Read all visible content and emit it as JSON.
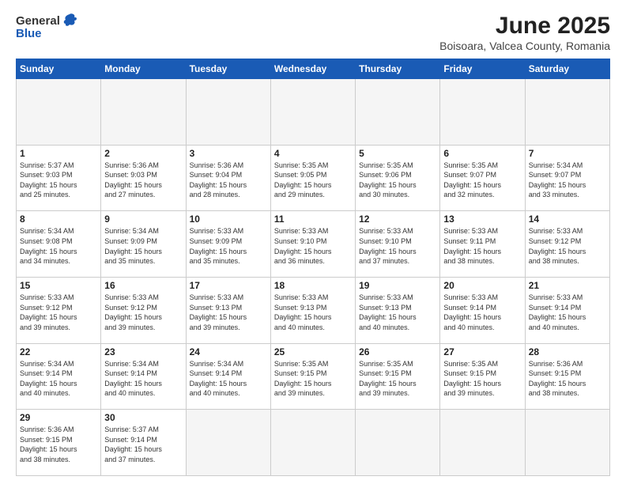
{
  "header": {
    "logo_general": "General",
    "logo_blue": "Blue",
    "title": "June 2025",
    "subtitle": "Boisoara, Valcea County, Romania"
  },
  "calendar": {
    "days_of_week": [
      "Sunday",
      "Monday",
      "Tuesday",
      "Wednesday",
      "Thursday",
      "Friday",
      "Saturday"
    ],
    "weeks": [
      [
        {
          "day": "",
          "empty": true
        },
        {
          "day": "",
          "empty": true
        },
        {
          "day": "",
          "empty": true
        },
        {
          "day": "",
          "empty": true
        },
        {
          "day": "",
          "empty": true
        },
        {
          "day": "",
          "empty": true
        },
        {
          "day": "",
          "empty": true
        }
      ],
      [
        {
          "day": "1",
          "sunrise": "5:37 AM",
          "sunset": "9:03 PM",
          "daylight": "15 hours and 25 minutes."
        },
        {
          "day": "2",
          "sunrise": "5:36 AM",
          "sunset": "9:03 PM",
          "daylight": "15 hours and 27 minutes."
        },
        {
          "day": "3",
          "sunrise": "5:36 AM",
          "sunset": "9:04 PM",
          "daylight": "15 hours and 28 minutes."
        },
        {
          "day": "4",
          "sunrise": "5:35 AM",
          "sunset": "9:05 PM",
          "daylight": "15 hours and 29 minutes."
        },
        {
          "day": "5",
          "sunrise": "5:35 AM",
          "sunset": "9:06 PM",
          "daylight": "15 hours and 30 minutes."
        },
        {
          "day": "6",
          "sunrise": "5:35 AM",
          "sunset": "9:07 PM",
          "daylight": "15 hours and 32 minutes."
        },
        {
          "day": "7",
          "sunrise": "5:34 AM",
          "sunset": "9:07 PM",
          "daylight": "15 hours and 33 minutes."
        }
      ],
      [
        {
          "day": "8",
          "sunrise": "5:34 AM",
          "sunset": "9:08 PM",
          "daylight": "15 hours and 34 minutes."
        },
        {
          "day": "9",
          "sunrise": "5:34 AM",
          "sunset": "9:09 PM",
          "daylight": "15 hours and 35 minutes."
        },
        {
          "day": "10",
          "sunrise": "5:33 AM",
          "sunset": "9:09 PM",
          "daylight": "15 hours and 35 minutes."
        },
        {
          "day": "11",
          "sunrise": "5:33 AM",
          "sunset": "9:10 PM",
          "daylight": "15 hours and 36 minutes."
        },
        {
          "day": "12",
          "sunrise": "5:33 AM",
          "sunset": "9:10 PM",
          "daylight": "15 hours and 37 minutes."
        },
        {
          "day": "13",
          "sunrise": "5:33 AM",
          "sunset": "9:11 PM",
          "daylight": "15 hours and 38 minutes."
        },
        {
          "day": "14",
          "sunrise": "5:33 AM",
          "sunset": "9:12 PM",
          "daylight": "15 hours and 38 minutes."
        }
      ],
      [
        {
          "day": "15",
          "sunrise": "5:33 AM",
          "sunset": "9:12 PM",
          "daylight": "15 hours and 39 minutes."
        },
        {
          "day": "16",
          "sunrise": "5:33 AM",
          "sunset": "9:12 PM",
          "daylight": "15 hours and 39 minutes."
        },
        {
          "day": "17",
          "sunrise": "5:33 AM",
          "sunset": "9:13 PM",
          "daylight": "15 hours and 39 minutes."
        },
        {
          "day": "18",
          "sunrise": "5:33 AM",
          "sunset": "9:13 PM",
          "daylight": "15 hours and 40 minutes."
        },
        {
          "day": "19",
          "sunrise": "5:33 AM",
          "sunset": "9:13 PM",
          "daylight": "15 hours and 40 minutes."
        },
        {
          "day": "20",
          "sunrise": "5:33 AM",
          "sunset": "9:14 PM",
          "daylight": "15 hours and 40 minutes."
        },
        {
          "day": "21",
          "sunrise": "5:33 AM",
          "sunset": "9:14 PM",
          "daylight": "15 hours and 40 minutes."
        }
      ],
      [
        {
          "day": "22",
          "sunrise": "5:34 AM",
          "sunset": "9:14 PM",
          "daylight": "15 hours and 40 minutes."
        },
        {
          "day": "23",
          "sunrise": "5:34 AM",
          "sunset": "9:14 PM",
          "daylight": "15 hours and 40 minutes."
        },
        {
          "day": "24",
          "sunrise": "5:34 AM",
          "sunset": "9:14 PM",
          "daylight": "15 hours and 40 minutes."
        },
        {
          "day": "25",
          "sunrise": "5:35 AM",
          "sunset": "9:15 PM",
          "daylight": "15 hours and 39 minutes."
        },
        {
          "day": "26",
          "sunrise": "5:35 AM",
          "sunset": "9:15 PM",
          "daylight": "15 hours and 39 minutes."
        },
        {
          "day": "27",
          "sunrise": "5:35 AM",
          "sunset": "9:15 PM",
          "daylight": "15 hours and 39 minutes."
        },
        {
          "day": "28",
          "sunrise": "5:36 AM",
          "sunset": "9:15 PM",
          "daylight": "15 hours and 38 minutes."
        }
      ],
      [
        {
          "day": "29",
          "sunrise": "5:36 AM",
          "sunset": "9:15 PM",
          "daylight": "15 hours and 38 minutes."
        },
        {
          "day": "30",
          "sunrise": "5:37 AM",
          "sunset": "9:14 PM",
          "daylight": "15 hours and 37 minutes."
        },
        {
          "day": "",
          "empty": true
        },
        {
          "day": "",
          "empty": true
        },
        {
          "day": "",
          "empty": true
        },
        {
          "day": "",
          "empty": true
        },
        {
          "day": "",
          "empty": true
        }
      ]
    ]
  }
}
